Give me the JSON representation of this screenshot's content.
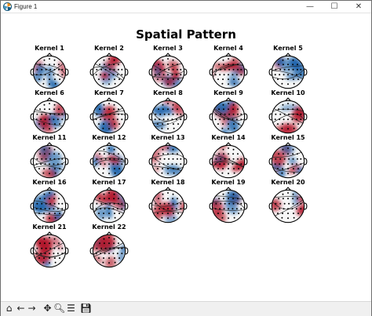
{
  "window": {
    "title": "Figure 1",
    "minimize_glyph": "—",
    "maximize_glyph": "☐",
    "close_glyph": "✕"
  },
  "figure": {
    "title": "Spatial Pattern",
    "kernels": [
      {
        "label": "Kernel 1"
      },
      {
        "label": "Kernel 2"
      },
      {
        "label": "Kernel 3"
      },
      {
        "label": "Kernel 4"
      },
      {
        "label": "Kernel 5"
      },
      {
        "label": "Kernel 6"
      },
      {
        "label": "Kernel 7"
      },
      {
        "label": "Kernel 8"
      },
      {
        "label": "Kernel 9"
      },
      {
        "label": "Kernel 10"
      },
      {
        "label": "Kernel 11"
      },
      {
        "label": "Kernel 12"
      },
      {
        "label": "Kernel 13"
      },
      {
        "label": "Kernel 14"
      },
      {
        "label": "Kernel 15"
      },
      {
        "label": "Kernel 16"
      },
      {
        "label": "Kernel 17"
      },
      {
        "label": "Kernel 18"
      },
      {
        "label": "Kernel 19"
      },
      {
        "label": "Kernel 20"
      },
      {
        "label": "Kernel 21"
      },
      {
        "label": "Kernel 22"
      }
    ],
    "colors": {
      "positive": "#b2182b",
      "negative": "#2166ac",
      "neutral": "#f7f7f7"
    }
  },
  "toolbar": {
    "items": [
      {
        "name": "home-icon",
        "glyph": "⌂"
      },
      {
        "name": "back-icon",
        "glyph": "←"
      },
      {
        "name": "forward-icon",
        "glyph": "→"
      },
      {
        "name": "pan-icon",
        "glyph": "✥"
      },
      {
        "name": "zoom-icon",
        "glyph": "🔍︎"
      },
      {
        "name": "configure-subplots-icon",
        "glyph": "☰"
      },
      {
        "name": "save-icon",
        "glyph": "💾︎"
      }
    ]
  }
}
